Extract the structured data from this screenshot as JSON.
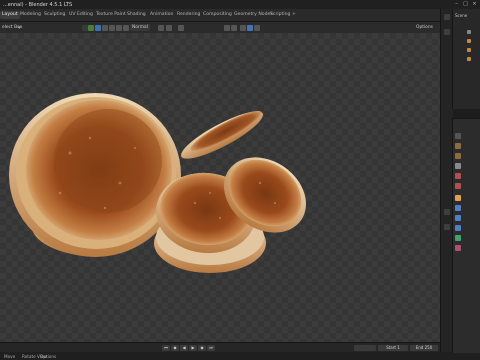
{
  "title_bar": {
    "title": "...ennal) - Blender 4.5.1 LTS",
    "minimize": "–",
    "maximize": "□",
    "close": "×"
  },
  "workspace_tabs": [
    "Layout",
    "Modeling",
    "Sculpting",
    "UV Editing",
    "Texture Paint",
    "Shading",
    "Animation",
    "Rendering",
    "Compositing",
    "Geometry Nodes",
    "Scripting",
    "+"
  ],
  "viewport_header": {
    "select_box": "elect Box",
    "orientation": "Normal",
    "options": "Options"
  },
  "timeline": {
    "start_label": "Start",
    "start_value": "1",
    "end_label": "End",
    "end_value": "250"
  },
  "status_bar": {
    "item1": "Move",
    "item2": "Rotate View",
    "item3": "Options"
  },
  "outliner": {
    "scene_label": "Scene"
  },
  "colors": {
    "viewport_bg": "#3b3b3b",
    "accent": "#4772b3",
    "pancake_outer": "#c9894a",
    "pancake_core": "#8f4a1e"
  }
}
